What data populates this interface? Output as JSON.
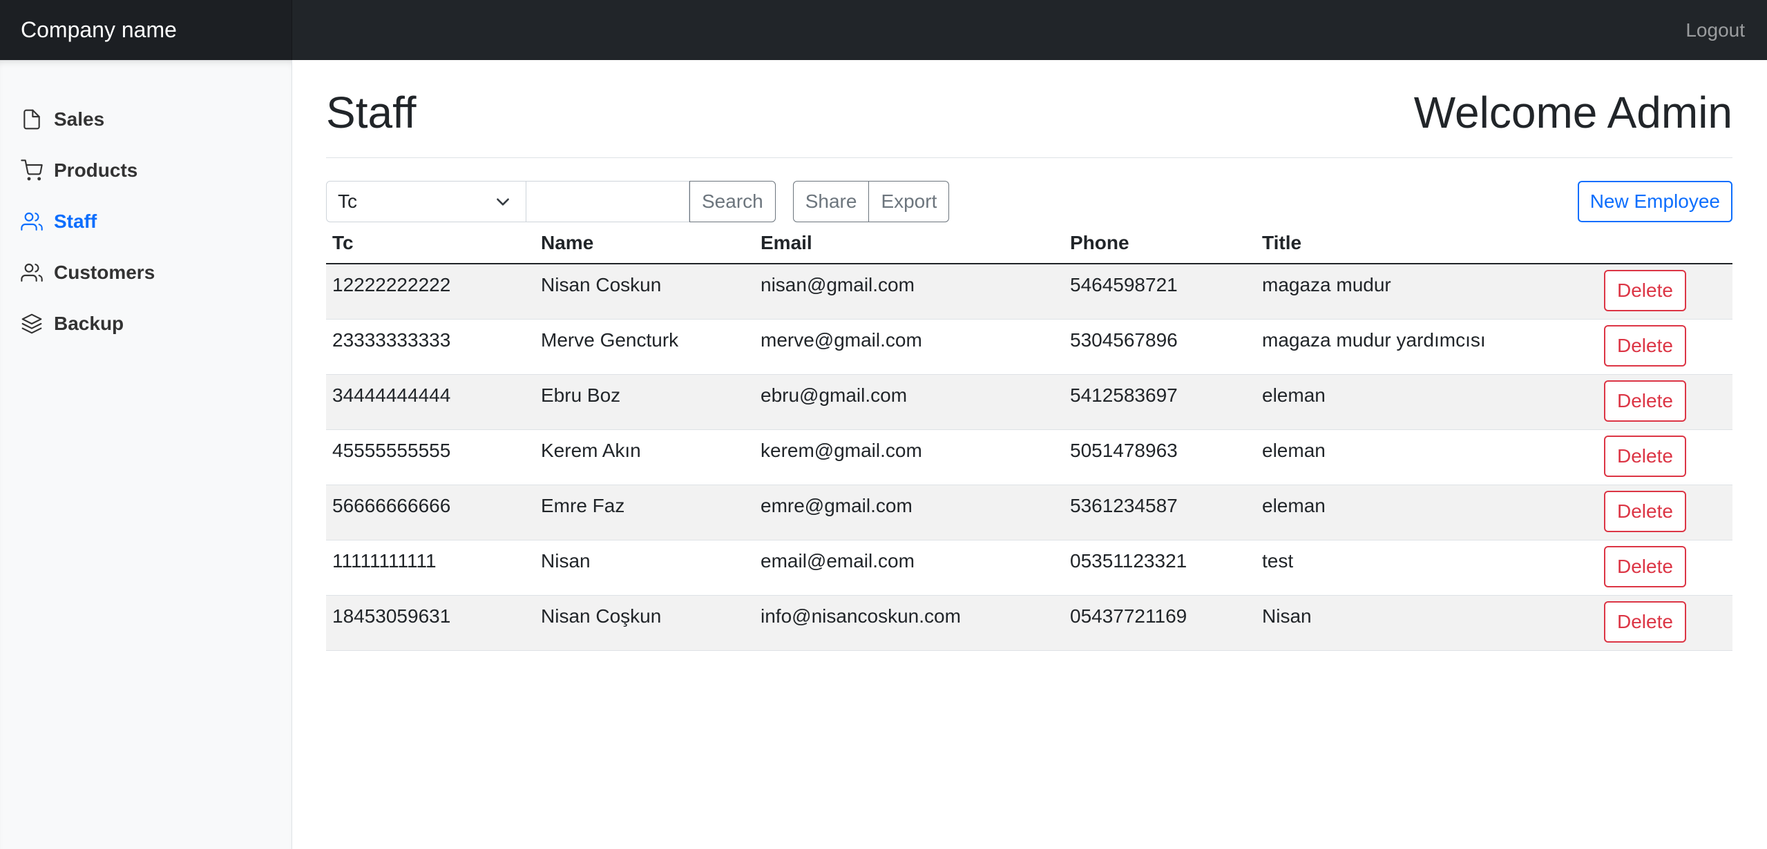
{
  "navbar": {
    "brand": "Company name",
    "logout": "Logout"
  },
  "sidebar": {
    "items": [
      {
        "label": "Sales",
        "icon": "file-icon",
        "active": false
      },
      {
        "label": "Products",
        "icon": "cart-icon",
        "active": false
      },
      {
        "label": "Staff",
        "icon": "users-icon",
        "active": true
      },
      {
        "label": "Customers",
        "icon": "users-icon",
        "active": false
      },
      {
        "label": "Backup",
        "icon": "layers-icon",
        "active": false
      }
    ]
  },
  "header": {
    "title": "Staff",
    "welcome": "Welcome Admin"
  },
  "toolbar": {
    "select_value": "Tc",
    "search_value": "",
    "search_label": "Search",
    "share_label": "Share",
    "export_label": "Export",
    "new_label": "New Employee"
  },
  "table": {
    "columns": [
      "Tc",
      "Name",
      "Email",
      "Phone",
      "Title"
    ],
    "delete_label": "Delete",
    "rows": [
      [
        "12222222222",
        "Nisan Coskun",
        "nisan@gmail.com",
        "5464598721",
        "magaza mudur"
      ],
      [
        "23333333333",
        "Merve Gencturk",
        "merve@gmail.com",
        "5304567896",
        "magaza mudur yardımcısı"
      ],
      [
        "34444444444",
        "Ebru Boz",
        "ebru@gmail.com",
        "5412583697",
        "eleman"
      ],
      [
        "45555555555",
        "Kerem Akın",
        "kerem@gmail.com",
        "5051478963",
        "eleman"
      ],
      [
        "56666666666",
        "Emre Faz",
        "emre@gmail.com",
        "5361234587",
        "eleman"
      ],
      [
        "11111111111",
        "Nisan",
        "email@email.com",
        "05351123321",
        "test"
      ],
      [
        "18453059631",
        "Nisan Coşkun",
        "info@nisancoskun.com",
        "05437721169",
        "Nisan"
      ]
    ]
  },
  "colors": {
    "accent": "#0d6efd",
    "danger": "#dc3545",
    "navbar": "#212529"
  }
}
